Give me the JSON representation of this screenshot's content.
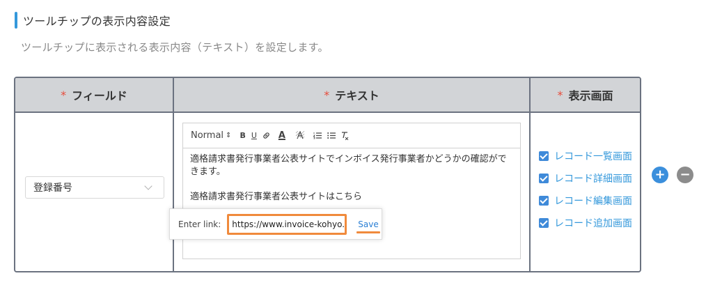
{
  "section": {
    "title": "ツールチップの表示内容設定",
    "description": "ツールチップに表示される表示内容（テキスト）を設定します。"
  },
  "table": {
    "headers": {
      "required_mark": "*",
      "field": "フィールド",
      "text": "テキスト",
      "screen": "表示画面"
    },
    "row": {
      "field_select": {
        "value": "登録番号"
      },
      "editor": {
        "toolbar": {
          "format": "Normal",
          "bold": "B",
          "underline": "U",
          "color": "A",
          "highlight": "A"
        },
        "content": [
          "適格請求書発行事業者公表サイトでインボイス発行事業者かどうかの確認ができます。",
          "",
          "適格請求書発行事業者公表サイトはこちら"
        ]
      },
      "link_popup": {
        "label": "Enter link:",
        "value": "https://www.invoice-kohyo.n",
        "save": "Save"
      },
      "screens": [
        {
          "label": "レコード一覧画面",
          "checked": true
        },
        {
          "label": "レコード詳細画面",
          "checked": true
        },
        {
          "label": "レコード編集画面",
          "checked": true
        },
        {
          "label": "レコード追加画面",
          "checked": true
        }
      ]
    }
  },
  "actions": {
    "add": "+",
    "remove": "−"
  },
  "colors": {
    "accent": "#3498db",
    "highlight_outline": "#f08a3c",
    "header_bg": "#d2d4d7"
  }
}
